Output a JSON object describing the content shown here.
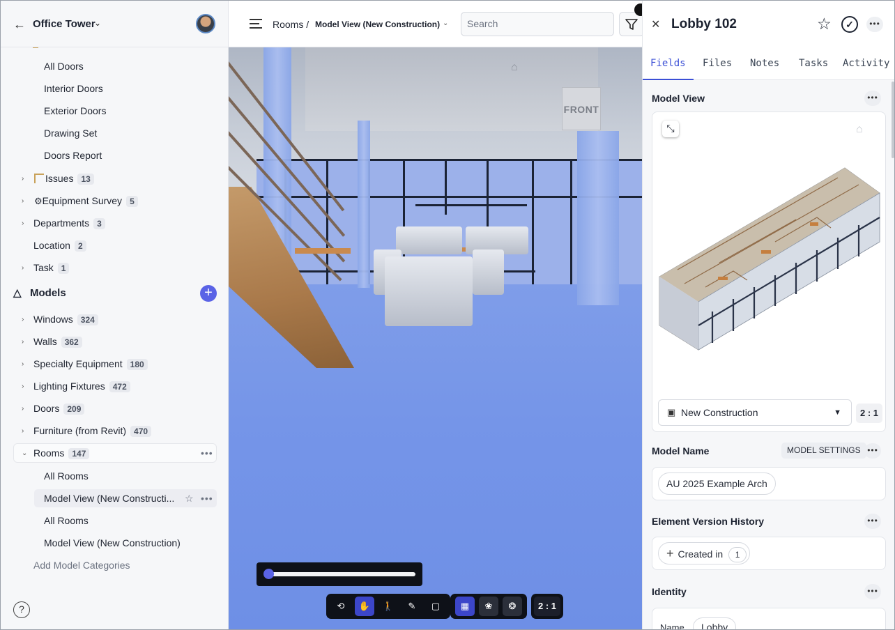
{
  "sidebar": {
    "project_title": "Office Tower",
    "doors_children": [
      "All Doors",
      "Interior Doors",
      "Exterior Doors",
      "Drawing Set",
      "Doors Report"
    ],
    "categories": [
      {
        "label": "Issues",
        "count": "13"
      },
      {
        "label": "Equipment Survey",
        "count": "5"
      },
      {
        "label": "Departments",
        "count": "3"
      },
      {
        "label": "Location",
        "count": "2"
      },
      {
        "label": "Task",
        "count": "1"
      }
    ],
    "models_title": "Models",
    "models": [
      {
        "label": "Windows",
        "count": "324"
      },
      {
        "label": "Walls",
        "count": "362"
      },
      {
        "label": "Specialty Equipment",
        "count": "180"
      },
      {
        "label": "Lighting Fixtures",
        "count": "472"
      },
      {
        "label": "Doors",
        "count": "209"
      },
      {
        "label": "Furniture (from Revit)",
        "count": "470"
      },
      {
        "label": "Rooms",
        "count": "147"
      }
    ],
    "rooms_children": [
      "All Rooms",
      "Model View (New Constructi...",
      "All Rooms",
      "Model View (New Construction)"
    ],
    "add_models_label": "Add Model Categories",
    "help_label": "?"
  },
  "topbar": {
    "crumb_root": "Rooms /",
    "crumb_current": "Model View (New Construction)",
    "search_placeholder": "Search"
  },
  "viewport": {
    "nav_cube_label": "FRONT",
    "ratio_label": "2 : 1",
    "slider_value": 0.0
  },
  "panel": {
    "title": "Lobby 102",
    "tabs": [
      "Fields",
      "Files",
      "Notes",
      "Tasks",
      "Activity"
    ],
    "active_tab": "Fields",
    "model_view_title": "Model View",
    "view_select": "New Construction",
    "view_ratio": "2 : 1",
    "model_name_title": "Model Name",
    "model_settings_label": "MODEL SETTINGS",
    "model_name_value": "AU 2025 Example Arch",
    "version_history_title": "Element Version History",
    "created_in_label": "Created in",
    "created_in_count": "1",
    "identity_title": "Identity",
    "identity_name_label": "Name",
    "identity_name_value": "Lobby"
  },
  "colors": {
    "accent": "#5a63e6",
    "tab_active": "#3b4fd6",
    "viewport_floor": "#7595e8",
    "toolbar_bg": "#0e1118"
  }
}
